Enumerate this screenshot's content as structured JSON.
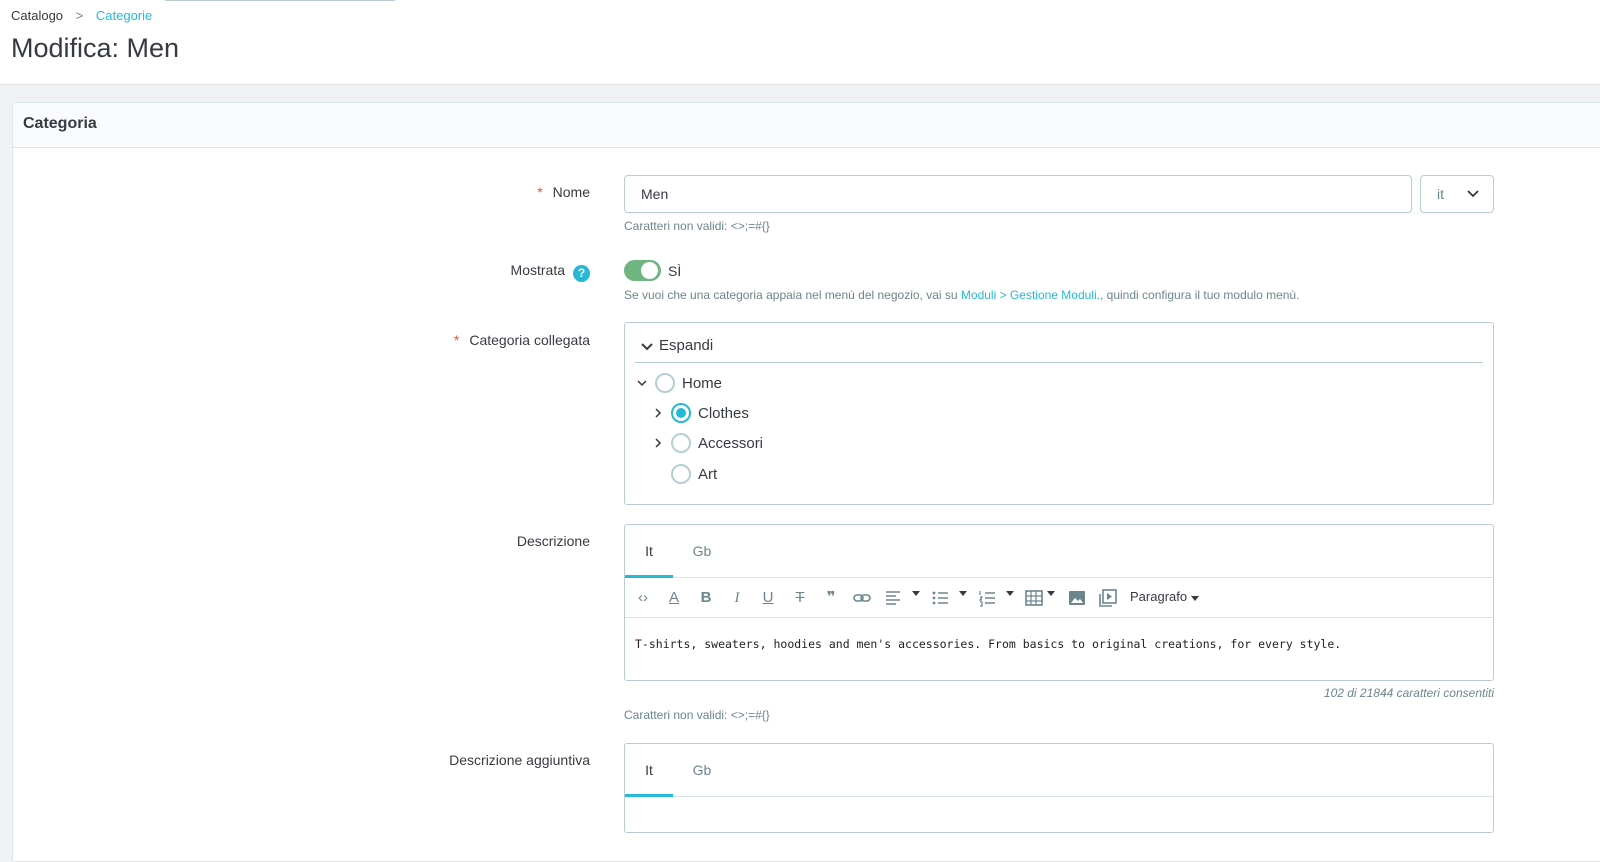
{
  "breadcrumb": {
    "parent": "Catalogo",
    "separator": ">",
    "current": "Categorie"
  },
  "page": {
    "title": "Modifica: Men"
  },
  "card": {
    "title": "Categoria"
  },
  "fields": {
    "name": {
      "required_mark": "*",
      "label": "Nome",
      "value": "Men",
      "language": "it",
      "hint": "Caratteri non validi: <>;=#{}"
    },
    "displayed": {
      "label": "Mostrata",
      "help_icon": "?",
      "toggle_on": true,
      "state_label": "SÌ",
      "hint_prefix": "Se vuoi che una categoria appaia nel menù del negozio, vai su",
      "hint_link": "Moduli > Gestione Moduli.",
      "hint_suffix": ", quindi configura il tuo modulo menù."
    },
    "parent_category": {
      "required_mark": "*",
      "label": "Categoria collegata",
      "expand_label": "Espandi",
      "tree": [
        {
          "label": "Home",
          "selected": false,
          "expanded": true
        },
        {
          "label": "Clothes",
          "selected": true,
          "expanded": false
        },
        {
          "label": "Accessori",
          "selected": false,
          "expanded": false
        },
        {
          "label": "Art",
          "selected": false,
          "expanded": false
        }
      ]
    },
    "description": {
      "label": "Descrizione",
      "tabs": [
        "It",
        "Gb"
      ],
      "active_tab": "It",
      "format_label": "Paragrafo",
      "content": "T-shirts, sweaters, hoodies and men's accessories. From basics to original creations, for every style.",
      "counter": "102 di 21844 caratteri consentiti",
      "hint": "Caratteri non validi: <>;=#{}"
    },
    "additional_description": {
      "label": "Descrizione aggiuntiva",
      "tabs": [
        "It",
        "Gb"
      ],
      "active_tab": "It"
    }
  }
}
